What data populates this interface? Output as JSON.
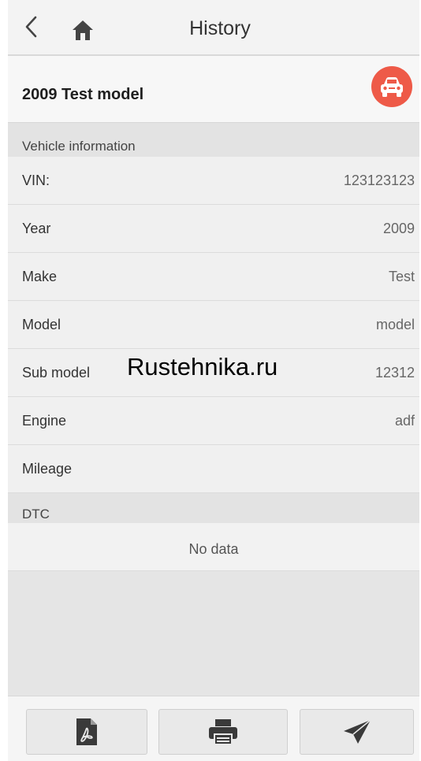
{
  "header": {
    "title": "History",
    "back_icon": "chevron-left-icon",
    "home_icon": "home-icon"
  },
  "vehicle": {
    "title": "2009 Test model",
    "badge_icon": "car-icon",
    "badge_color": "#ee5a48"
  },
  "sections": {
    "vehicle_info": "Vehicle information",
    "dtc": "DTC"
  },
  "info_rows": [
    {
      "label": "VIN:",
      "value": "123123123"
    },
    {
      "label": "Year",
      "value": "2009"
    },
    {
      "label": "Make",
      "value": "Test"
    },
    {
      "label": "Model",
      "value": "model"
    },
    {
      "label": "Sub model",
      "value": "12312"
    },
    {
      "label": "Engine",
      "value": "adf"
    },
    {
      "label": "Mileage",
      "value": ""
    }
  ],
  "dtc": {
    "empty_text": "No data"
  },
  "watermark": "Rustehnika.ru",
  "bottom_bar": {
    "buttons": [
      {
        "icon": "pdf-icon"
      },
      {
        "icon": "printer-icon"
      },
      {
        "icon": "send-icon"
      }
    ]
  }
}
